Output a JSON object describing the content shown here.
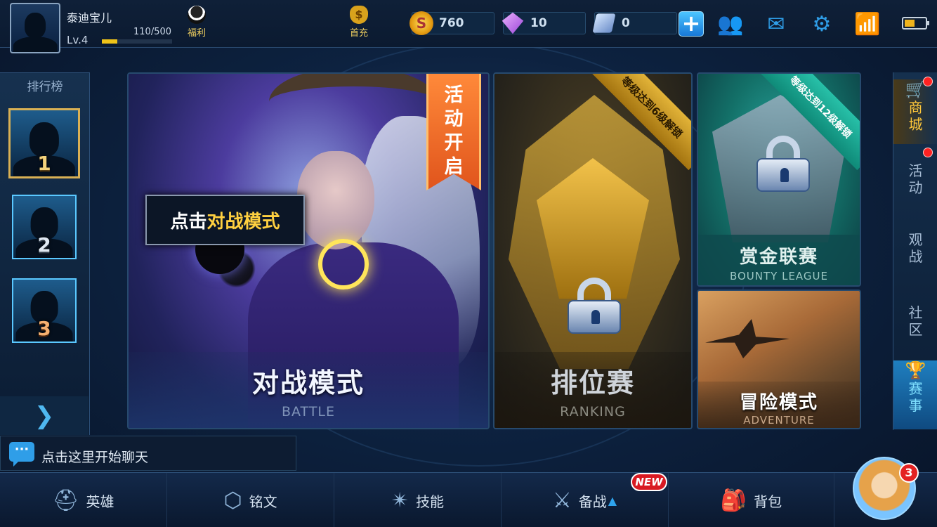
{
  "player": {
    "name": "泰迪宝儿",
    "level": "Lv.4",
    "exp": "110/500",
    "exp_fraction": 0.22
  },
  "top": {
    "welfare": "福利",
    "first_recharge": "首充",
    "first_recharge_glyph": "$",
    "gold_glyph": "S",
    "gold": "760",
    "gems": "10",
    "coupons": "0",
    "add_glyph": "+"
  },
  "icons": {
    "friends": "friends-icon",
    "mail": "mail-icon",
    "settings": "gear-icon",
    "wifi": "wifi-icon",
    "battery": "battery-icon"
  },
  "rank": {
    "title": "排行榜",
    "places": [
      "1",
      "2",
      "3"
    ]
  },
  "cards": {
    "battle": {
      "title": "对战模式",
      "sub": "BATTLE",
      "event": "活动开启"
    },
    "tooltip": {
      "prefix": "点击",
      "highlight": "对战模式"
    },
    "ranking": {
      "title": "排位赛",
      "sub": "RANKING",
      "unlock": "等级达到6级解锁"
    },
    "bounty": {
      "title": "赏金联赛",
      "sub": "BOUNTY LEAGUE",
      "unlock": "等级达到12级解锁"
    },
    "adventure": {
      "title": "冒险模式",
      "sub": "ADVENTURE"
    }
  },
  "rightnav": {
    "shop": "商城",
    "activity": "活动",
    "watch": "观战",
    "community": "社区",
    "event": "赛事"
  },
  "chat": {
    "placeholder": "点击这里开始聊天",
    "icon_glyph": "···"
  },
  "bottom": {
    "hero": "英雄",
    "rune": "铭文",
    "skill": "技能",
    "prep": "备战",
    "bag": "背包",
    "new_badge": "NEW"
  },
  "mascot": {
    "notifications": "3"
  },
  "colors": {
    "accent_blue": "#2f9ee8",
    "gold": "#f0c419",
    "event_orange": "#e0541c",
    "badge_red": "#d91a22"
  }
}
